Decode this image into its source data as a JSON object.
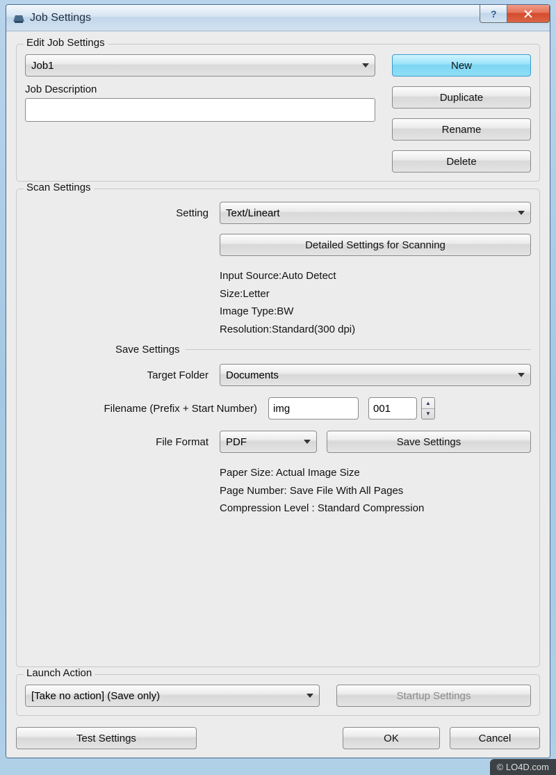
{
  "window": {
    "title": "Job Settings"
  },
  "edit_job": {
    "group_label": "Edit Job Settings",
    "job_select_value": "Job1",
    "job_description_label": "Job Description",
    "job_description_value": "",
    "buttons": {
      "new": "New",
      "duplicate": "Duplicate",
      "rename": "Rename",
      "delete": "Delete"
    }
  },
  "scan": {
    "group_label": "Scan Settings",
    "setting_label": "Setting",
    "setting_value": "Text/Lineart",
    "detailed_button": "Detailed Settings for Scanning",
    "info_input_source": "Input Source:Auto Detect",
    "info_size": "Size:Letter",
    "info_image_type": "Image Type:BW",
    "info_resolution": "Resolution:Standard(300 dpi)",
    "save_settings_label": "Save Settings",
    "target_folder_label": "Target Folder",
    "target_folder_value": "Documents",
    "filename_label": "Filename (Prefix + Start Number)",
    "filename_prefix": "img",
    "filename_number": "001",
    "file_format_label": "File Format",
    "file_format_value": "PDF",
    "save_settings_button": "Save Settings",
    "info_paper_size": "Paper Size: Actual Image Size",
    "info_page_number": "Page Number: Save File With All Pages",
    "info_compression": "Compression Level : Standard Compression"
  },
  "launch": {
    "group_label": "Launch Action",
    "action_value": "[Take no action] (Save only)",
    "startup_button": "Startup Settings"
  },
  "footer": {
    "test": "Test Settings",
    "ok": "OK",
    "cancel": "Cancel"
  },
  "watermark": "© LO4D.com"
}
